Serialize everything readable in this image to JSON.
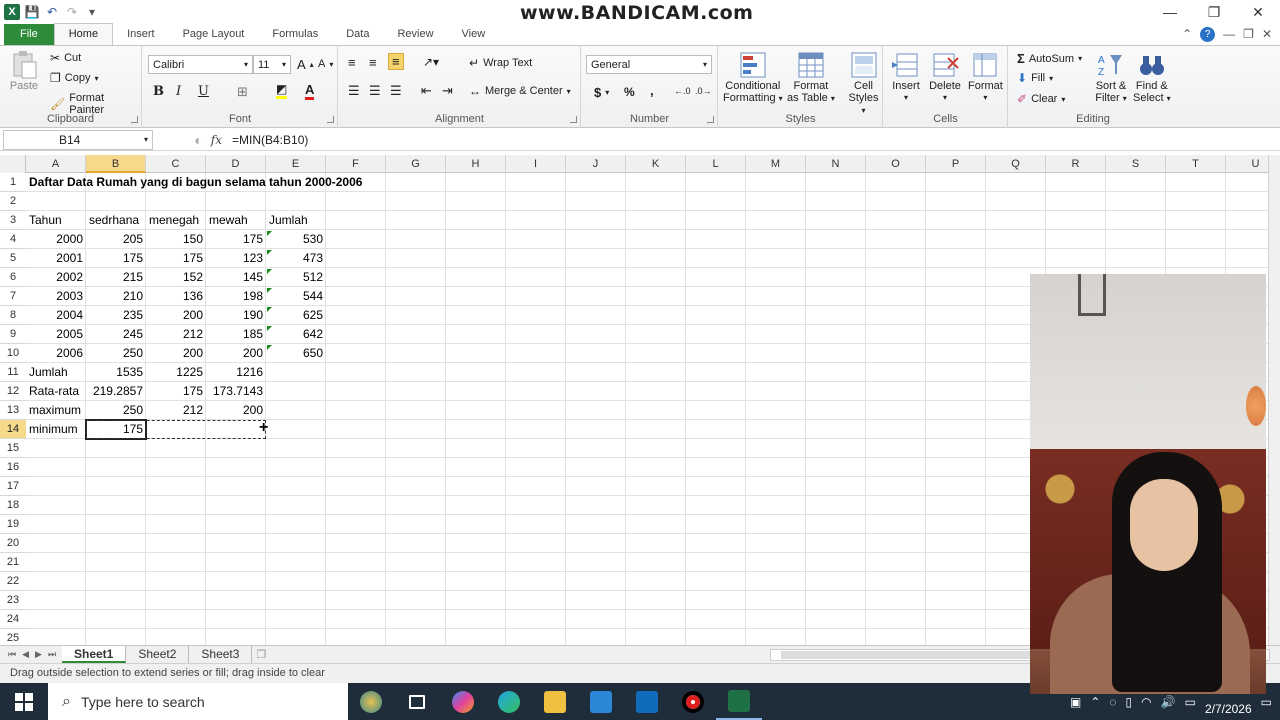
{
  "watermark": "www.BANDICAM.com",
  "titlebar": {
    "app_logo": "X",
    "window_controls": [
      "minimize",
      "restore",
      "close"
    ]
  },
  "tabs": [
    "File",
    "Home",
    "Insert",
    "Page Layout",
    "Formulas",
    "Data",
    "Review",
    "View"
  ],
  "ribbon": {
    "clipboard": {
      "paste": "Paste",
      "cut": "Cut",
      "copy": "Copy",
      "format_painter": "Format Painter",
      "label": "Clipboard"
    },
    "font": {
      "family": "Calibri",
      "size": "11",
      "bold": "B",
      "italic": "I",
      "underline": "U",
      "label": "Font"
    },
    "alignment": {
      "wrap": "Wrap Text",
      "merge": "Merge & Center",
      "label": "Alignment"
    },
    "number": {
      "format": "General",
      "currency": "$",
      "percent": "%",
      "comma": ",",
      "label": "Number"
    },
    "styles": {
      "conditional": [
        "Conditional",
        "Formatting"
      ],
      "format_table": [
        "Format",
        "as Table"
      ],
      "cell_styles": [
        "Cell",
        "Styles"
      ],
      "label": "Styles"
    },
    "cells": {
      "insert": "Insert",
      "delete": "Delete",
      "format": "Format",
      "label": "Cells"
    },
    "editing": {
      "autosum": "AutoSum",
      "fill": "Fill",
      "clear": "Clear",
      "sort": [
        "Sort &",
        "Filter"
      ],
      "find": [
        "Find &",
        "Select"
      ],
      "label": "Editing"
    }
  },
  "formula_bar": {
    "name_box": "B14",
    "fx": "fx",
    "formula": "=MIN(B4:B10)"
  },
  "columns": [
    "A",
    "B",
    "C",
    "D",
    "E",
    "F",
    "G",
    "H",
    "I",
    "J",
    "K",
    "L",
    "M",
    "N",
    "O",
    "P",
    "Q",
    "R",
    "S",
    "T",
    "U"
  ],
  "rows": [
    "1",
    "2",
    "3",
    "4",
    "5",
    "6",
    "7",
    "8",
    "9",
    "10",
    "11",
    "12",
    "13",
    "14",
    "15",
    "16",
    "17",
    "18",
    "19",
    "20",
    "21",
    "22",
    "23",
    "24",
    "25"
  ],
  "sheet": {
    "title": "Daftar Data Rumah yang di bagun selama tahun 2000-2006",
    "headers": [
      "Tahun",
      "sedrhana",
      "menegah",
      "mewah",
      "Jumlah"
    ],
    "data": [
      [
        "2000",
        "205",
        "150",
        "175",
        "530"
      ],
      [
        "2001",
        "175",
        "175",
        "123",
        "473"
      ],
      [
        "2002",
        "215",
        "152",
        "145",
        "512"
      ],
      [
        "2003",
        "210",
        "136",
        "198",
        "544"
      ],
      [
        "2004",
        "235",
        "200",
        "190",
        "625"
      ],
      [
        "2005",
        "245",
        "212",
        "185",
        "642"
      ],
      [
        "2006",
        "250",
        "200",
        "200",
        "650"
      ]
    ],
    "summary": [
      [
        "Jumlah",
        "1535",
        "1225",
        "1216"
      ],
      [
        "Rata-rata",
        "219.2857",
        "175",
        "173.7143"
      ],
      [
        "maximum",
        "250",
        "212",
        "200"
      ],
      [
        "minimum",
        "175",
        "",
        ""
      ]
    ]
  },
  "sheet_tabs": [
    "Sheet1",
    "Sheet2",
    "Sheet3"
  ],
  "status": "Drag outside selection to extend series or fill; drag inside to clear",
  "taskbar": {
    "search_placeholder": "Type here to search",
    "date": "2/7/2026"
  },
  "colors": {
    "excel_green": "#2e8b3a",
    "selection_header": "#f7d98c",
    "taskbar": "#1f2d3b"
  }
}
